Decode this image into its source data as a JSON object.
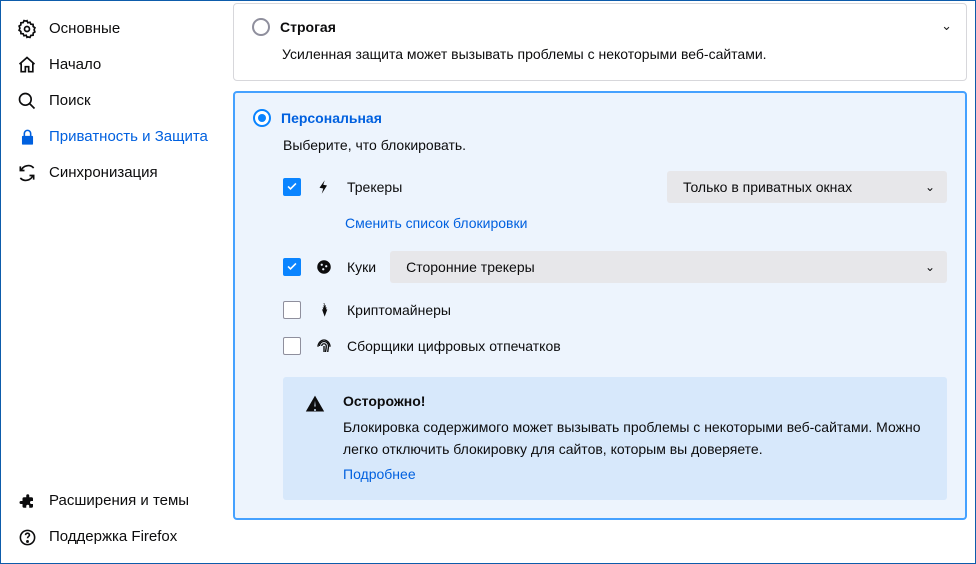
{
  "sidebar": {
    "items": [
      {
        "label": "Основные"
      },
      {
        "label": "Начало"
      },
      {
        "label": "Поиск"
      },
      {
        "label": "Приватность и Защита"
      },
      {
        "label": "Синхронизация"
      }
    ],
    "footer": [
      {
        "label": "Расширения и темы"
      },
      {
        "label": "Поддержка Firefox"
      }
    ]
  },
  "strict": {
    "title": "Строгая",
    "desc": "Усиленная защита может вызывать проблемы с некоторыми веб-сайтами."
  },
  "personal": {
    "title": "Персональная",
    "sub": "Выберите, что блокировать.",
    "trackers_label": "Трекеры",
    "trackers_select": "Только в приватных окнах",
    "change_list": "Сменить список блокировки",
    "cookies_label": "Куки",
    "cookies_select": "Сторонние трекеры",
    "crypto_label": "Криптомайнеры",
    "fp_label": "Сборщики цифровых отпечатков"
  },
  "warn": {
    "title": "Осторожно!",
    "text": "Блокировка содержимого может вызывать проблемы с некоторыми веб-сайтами. Можно легко отключить блокировку для сайтов, которым вы доверяете.",
    "link": "Подробнее"
  }
}
